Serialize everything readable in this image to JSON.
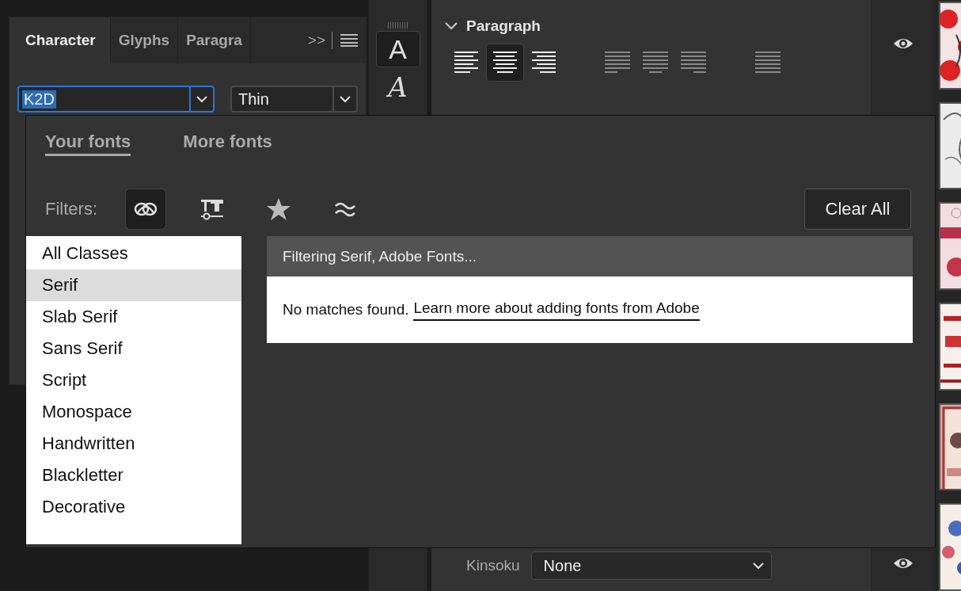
{
  "character_panel": {
    "tabs": [
      {
        "label": "Character",
        "selected": true
      },
      {
        "label": "Glyphs",
        "selected": false
      },
      {
        "label": "Paragra",
        "selected": false
      }
    ],
    "overflow": ">>",
    "font_family": {
      "value": "K2D",
      "focused": true
    },
    "font_style": {
      "value": "Thin"
    }
  },
  "tool_strip": [
    {
      "label": "A",
      "kind": "regular",
      "selected": true
    },
    {
      "label": "A",
      "kind": "swash",
      "selected": false
    }
  ],
  "paragraph_panel": {
    "title": "Paragraph",
    "expanded": true,
    "alignment": [
      {
        "kind": "left",
        "selected": false
      },
      {
        "kind": "center",
        "selected": true
      },
      {
        "kind": "right",
        "selected": false
      },
      {
        "kind": "justify-left",
        "selected": false
      },
      {
        "kind": "justify-center",
        "selected": false
      },
      {
        "kind": "justify-right",
        "selected": false
      },
      {
        "kind": "justify-all",
        "selected": false
      }
    ],
    "kinsoku": {
      "label": "Kinsoku",
      "value": "None"
    }
  },
  "font_popup": {
    "tabs": [
      {
        "label": "Your fonts",
        "selected": true
      },
      {
        "label": "More fonts",
        "selected": false
      }
    ],
    "filters_label": "Filters:",
    "filters": [
      {
        "kind": "creative-cloud",
        "selected": true
      },
      {
        "kind": "installed",
        "selected": false
      },
      {
        "kind": "favorites",
        "selected": false
      },
      {
        "kind": "similar",
        "selected": false
      }
    ],
    "clear_button": "Clear All",
    "classes": [
      {
        "label": "All Classes",
        "selected": false
      },
      {
        "label": "Serif",
        "selected": true
      },
      {
        "label": "Slab Serif",
        "selected": false
      },
      {
        "label": "Sans Serif",
        "selected": false
      },
      {
        "label": "Script",
        "selected": false
      },
      {
        "label": "Monospace",
        "selected": false
      },
      {
        "label": "Handwritten",
        "selected": false
      },
      {
        "label": "Blackletter",
        "selected": false
      },
      {
        "label": "Decorative",
        "selected": false
      }
    ],
    "status": "Filtering Serif, Adobe Fonts...",
    "message": "No matches found.",
    "link": "Learn more about adding fonts from Adobe"
  }
}
